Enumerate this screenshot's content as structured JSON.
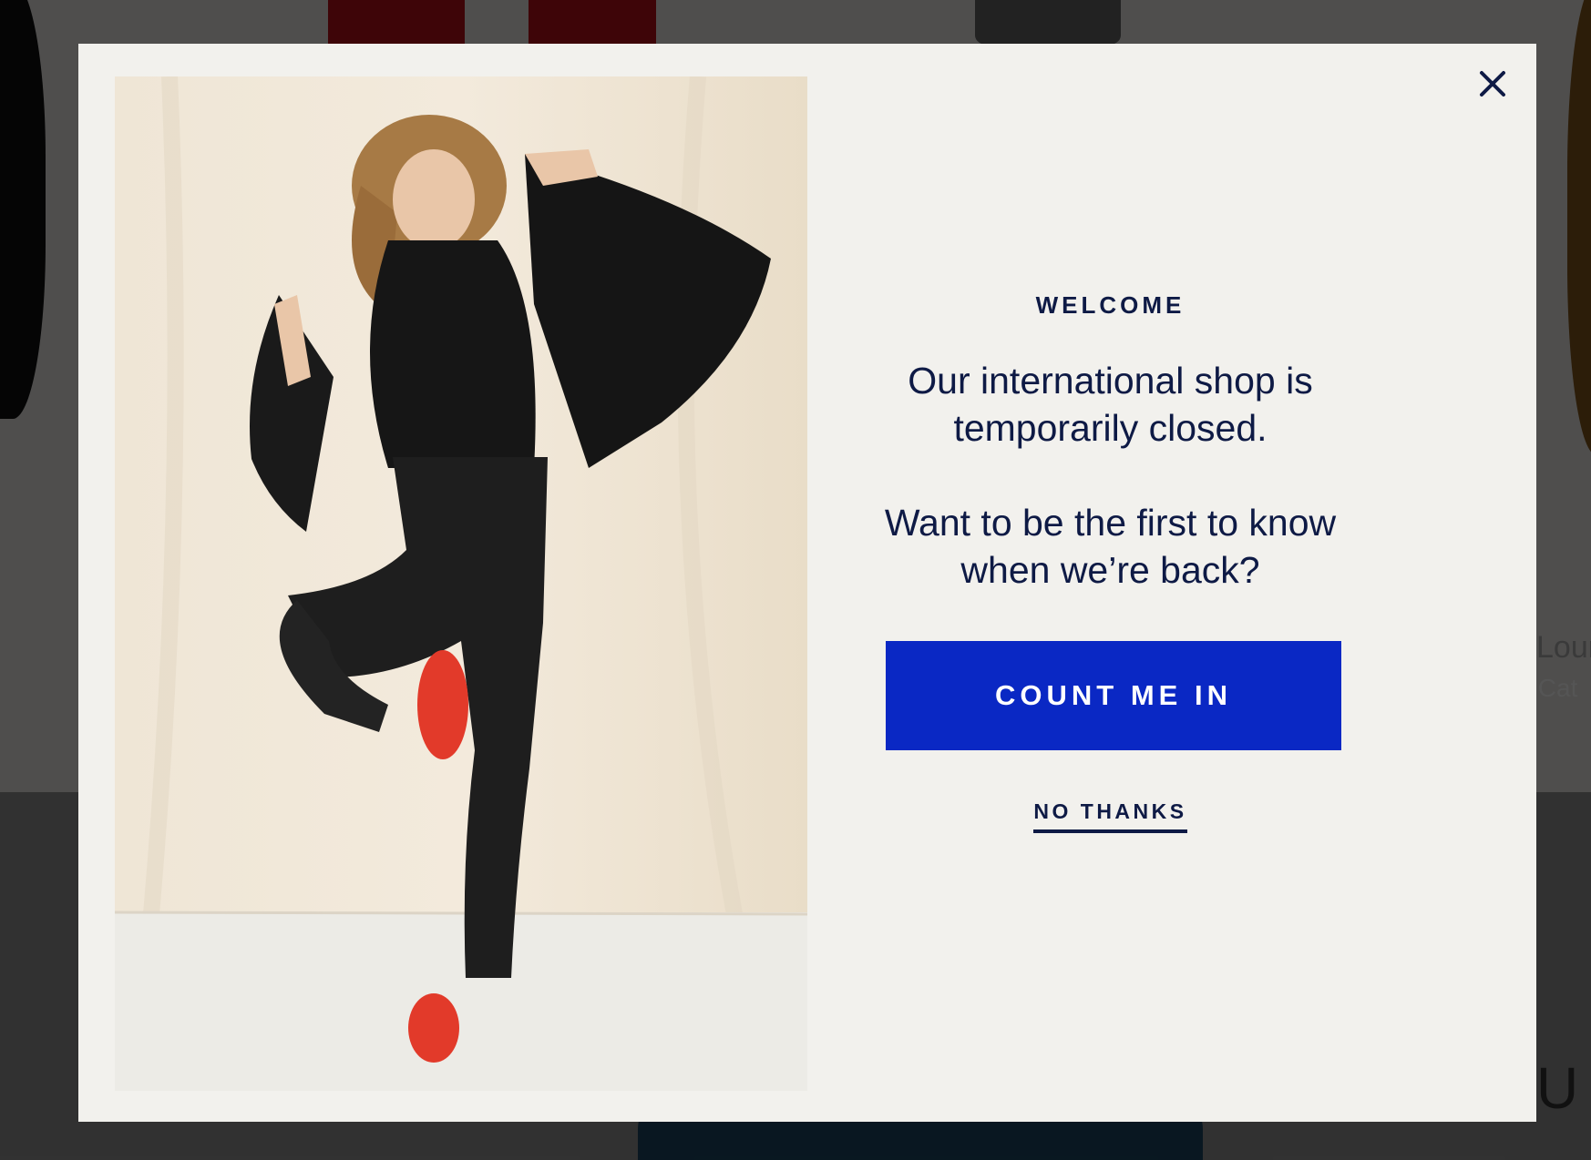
{
  "background": {
    "product_title_partial": "Lour",
    "product_subtitle_partial": "c Cat",
    "brand_partial": "UX"
  },
  "modal": {
    "eyebrow": "WELCOME",
    "headline": "Our international shop is temporarily closed.",
    "subheadline": "Want to be the first to know when we’re back?",
    "cta_label": "COUNT ME IN",
    "dismiss_label": "NO THANKS",
    "close_icon": "close-icon",
    "colors": {
      "background": "#f2f1ed",
      "text": "#0e1a45",
      "cta_background": "#0a28c4",
      "cta_text": "#ffffff"
    }
  }
}
